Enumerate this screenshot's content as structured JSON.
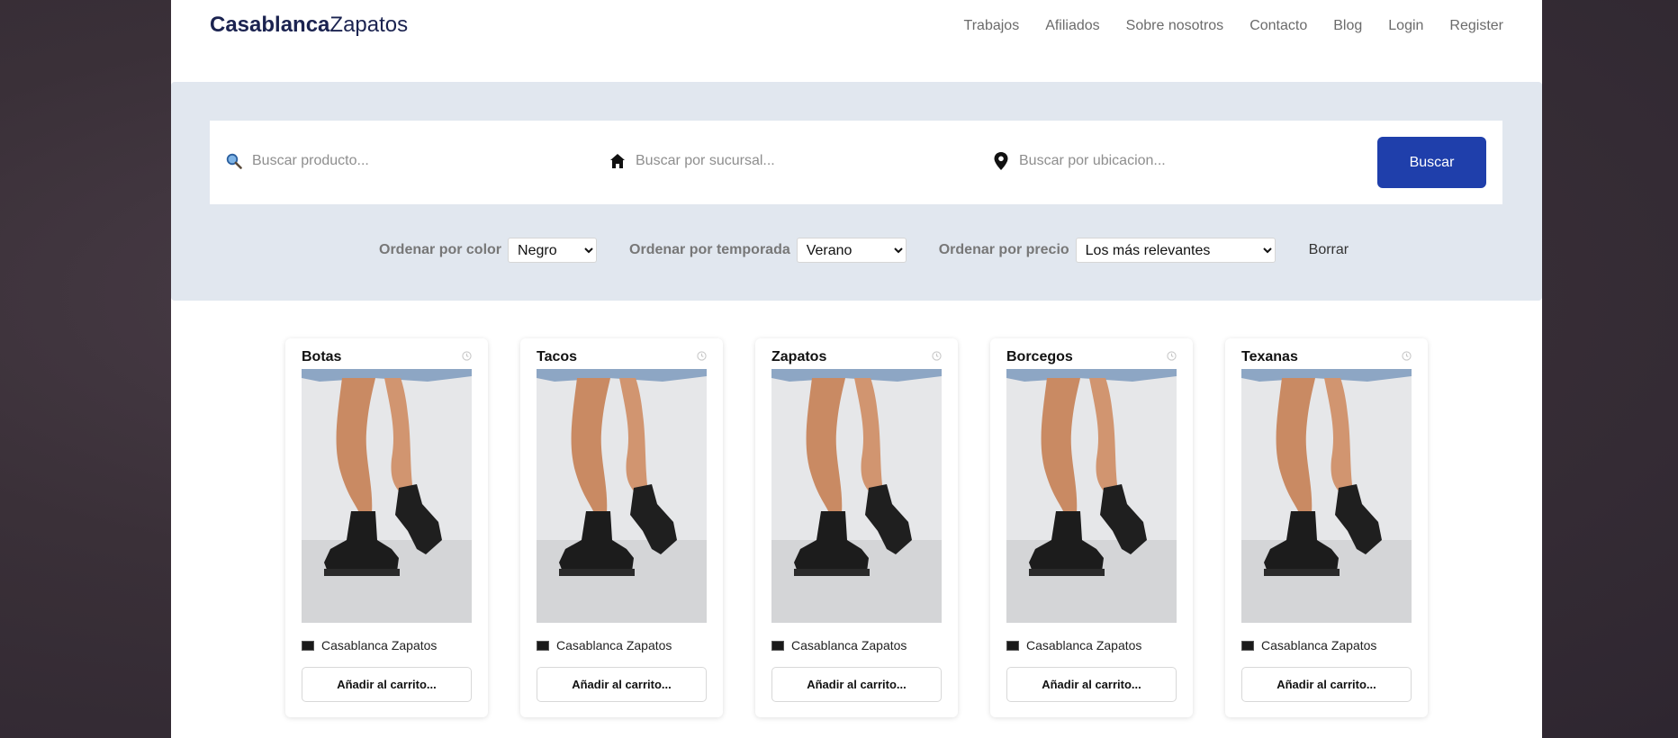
{
  "brand": {
    "part1": "Casablanca",
    "part2": "Zapatos"
  },
  "nav": [
    "Trabajos",
    "Afiliados",
    "Sobre nosotros",
    "Contacto",
    "Blog",
    "Login",
    "Register"
  ],
  "search": {
    "product_placeholder": "Buscar producto...",
    "branch_placeholder": "Buscar por sucursal...",
    "location_placeholder": "Buscar por ubicacion...",
    "button": "Buscar"
  },
  "filters": {
    "color_label": "Ordenar por color",
    "color_value": "Negro",
    "season_label": "Ordenar por temporada",
    "season_value": "Verano",
    "price_label": "Ordenar por precio",
    "price_value": "Los más relevantes",
    "clear": "Borrar"
  },
  "products": [
    {
      "title": "Botas",
      "store": "Casablanca Zapatos",
      "button": "Añadir al carrito..."
    },
    {
      "title": "Tacos",
      "store": "Casablanca Zapatos",
      "button": "Añadir al carrito..."
    },
    {
      "title": "Zapatos",
      "store": "Casablanca Zapatos",
      "button": "Añadir al carrito..."
    },
    {
      "title": "Borcegos",
      "store": "Casablanca Zapatos",
      "button": "Añadir al carrito..."
    },
    {
      "title": "Texanas",
      "store": "Casablanca Zapatos",
      "button": "Añadir al carrito..."
    }
  ],
  "colors": {
    "brand_text": "#1b2350",
    "primary_button": "#1f3fab",
    "panel_bg": "#e1e7ef"
  }
}
